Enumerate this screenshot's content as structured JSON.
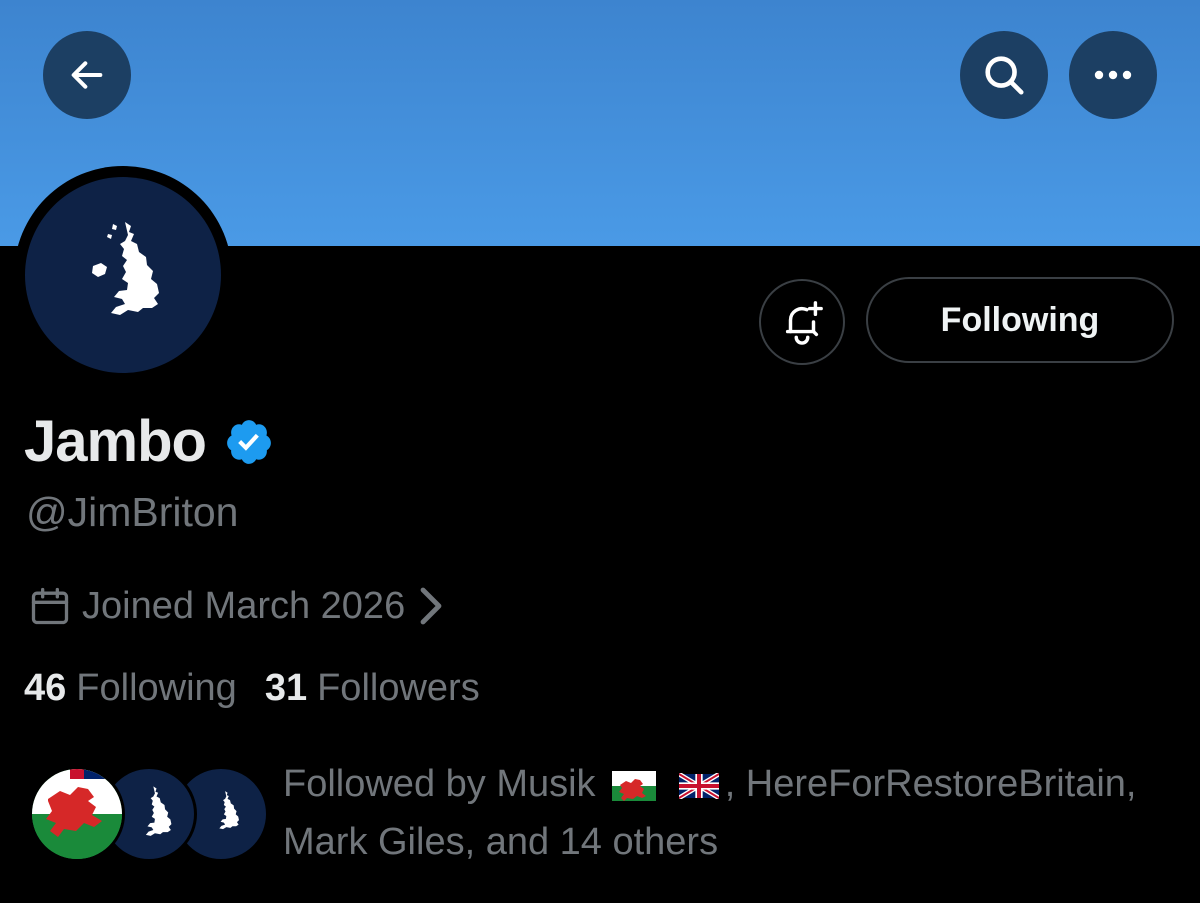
{
  "profile": {
    "display_name": "Jambo",
    "handle": "@JimBriton",
    "verified": true,
    "joined": "Joined March 2026",
    "following_count": "46",
    "following_label": "Following",
    "followers_count": "31",
    "followers_label": "Followers"
  },
  "actions": {
    "follow_button_label": "Following"
  },
  "followed_by": {
    "prefix": "Followed by Musik",
    "suffix": ", HereForRestoreBritain,",
    "line2": "Mark Giles, and 14 others"
  },
  "colors": {
    "banner": "#4a9ae6",
    "header_button_bg": "#1c3f63",
    "avatar_bg": "#0e2246",
    "verified": "#1d9bf0",
    "muted_text": "#71767b"
  },
  "icons": [
    "back-arrow-icon",
    "search-icon",
    "more-icon",
    "notification-bell-add-icon",
    "verified-badge-icon",
    "calendar-icon",
    "chevron-right-icon",
    "uk-map-icon",
    "welsh-flag-icon",
    "union-jack-icon"
  ]
}
